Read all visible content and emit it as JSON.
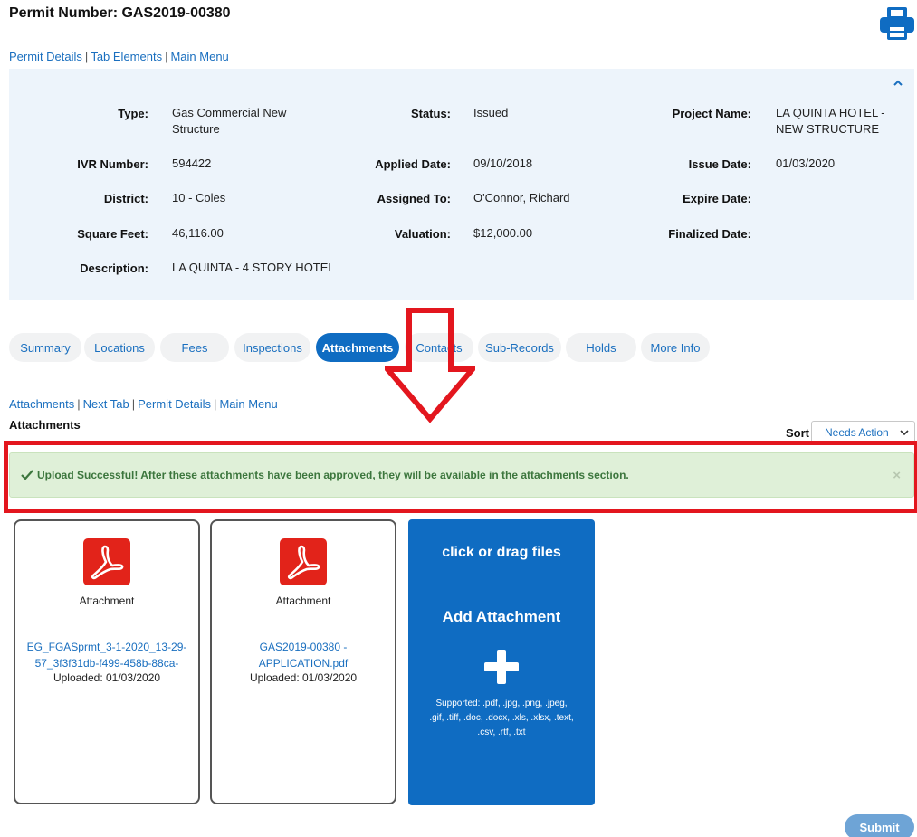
{
  "header": {
    "title": "Permit Number: GAS2019-00380"
  },
  "top_nav": [
    "Permit Details",
    "Tab Elements",
    "Main Menu"
  ],
  "details": {
    "fields": [
      {
        "label": "Type:",
        "value": "Gas Commercial New Structure"
      },
      {
        "label": "Status:",
        "value": "Issued"
      },
      {
        "label": "Project Name:",
        "value": "LA QUINTA HOTEL - NEW STRUCTURE"
      },
      {
        "label": "IVR Number:",
        "value": "594422"
      },
      {
        "label": "Applied Date:",
        "value": "09/10/2018"
      },
      {
        "label": "Issue Date:",
        "value": "01/03/2020"
      },
      {
        "label": "District:",
        "value": "10 - Coles"
      },
      {
        "label": "Assigned To:",
        "value": "O'Connor, Richard"
      },
      {
        "label": "Expire Date:",
        "value": ""
      },
      {
        "label": "Square Feet:",
        "value": "46,116.00"
      },
      {
        "label": "Valuation:",
        "value": "$12,000.00"
      },
      {
        "label": "Finalized Date:",
        "value": ""
      },
      {
        "label": "Description:",
        "value": "LA QUINTA - 4 STORY HOTEL"
      }
    ]
  },
  "tabs": [
    {
      "label": "Summary"
    },
    {
      "label": "Locations"
    },
    {
      "label": "Fees"
    },
    {
      "label": "Inspections"
    },
    {
      "label": "Attachments",
      "active": true
    },
    {
      "label": "Contacts"
    },
    {
      "label": "Sub-Records"
    },
    {
      "label": "Holds"
    },
    {
      "label": "More Info"
    }
  ],
  "section_nav": [
    "Attachments",
    "Next Tab",
    "Permit Details",
    "Main Menu"
  ],
  "section": {
    "title": "Attachments",
    "sort_label": "Sort",
    "sort_value": "Needs Action"
  },
  "alert": {
    "message": "Upload Successful! After these attachments have been approved, they will be available in the attachments section.",
    "close": "×"
  },
  "attachments": [
    {
      "label": "Attachment",
      "filename": "EG_FGASprmt_3-1-2020_13-29-57_3f3f31db-f499-458b-88ca-",
      "uploaded": "Uploaded: 01/03/2020"
    },
    {
      "label": "Attachment",
      "filename": "GAS2019-00380 - APPLICATION.pdf",
      "uploaded": "Uploaded: 01/03/2020"
    }
  ],
  "dropzone": {
    "title": "click or drag files",
    "add": "Add Attachment",
    "supported": "Supported: .pdf, .jpg, .png, .jpeg, .gif, .tiff, .doc, .docx, .xls, .xlsx, .text, .csv, .rtf, .txt"
  },
  "submit_label": "Submit",
  "colors": {
    "primary": "#0f6cc2",
    "link": "#1a6fbf",
    "panel": "#edf4fb",
    "success_bg": "#dff0d8",
    "success_text": "#3c763d",
    "annotation_red": "#e3161e",
    "pdf_red": "#e2231a"
  }
}
